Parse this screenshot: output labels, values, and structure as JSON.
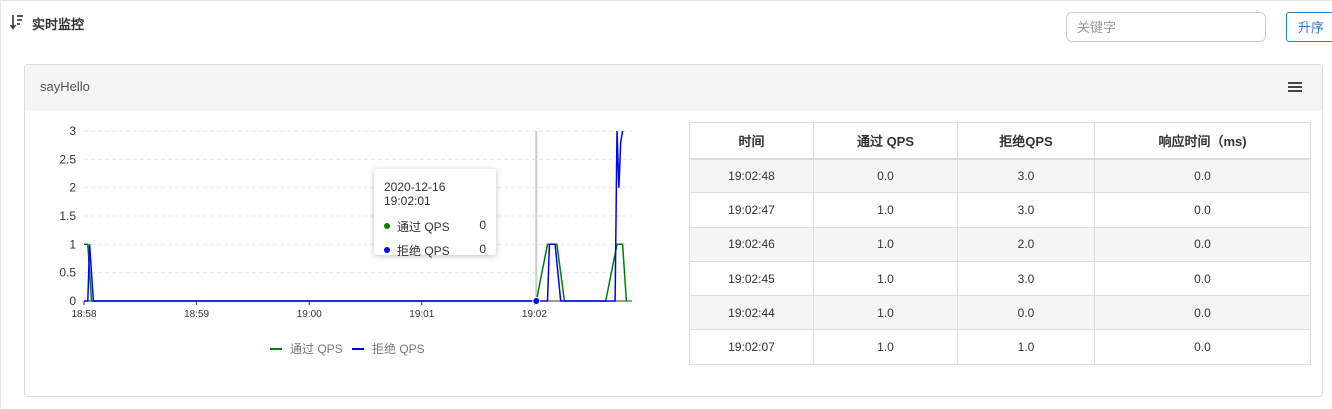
{
  "header": {
    "title": "实时监控",
    "search_placeholder": "关键字",
    "sort_button": "升序"
  },
  "panel": {
    "title": "sayHello"
  },
  "colors": {
    "pass": "#008000",
    "block": "#0000ff",
    "accent": "#2a7ec6"
  },
  "chart_data": {
    "type": "line",
    "y_ticks": [
      "0",
      "0.5",
      "1",
      "1.5",
      "2",
      "2.5",
      "3"
    ],
    "ylim": [
      0,
      3
    ],
    "x_ticks": [
      "18:58",
      "18:59",
      "19:00",
      "19:01",
      "19:02"
    ],
    "legend_position": "bottom",
    "series": [
      {
        "name": "通过 QPS",
        "color": "#008000",
        "points": [
          [
            "18:58:00",
            1
          ],
          [
            "18:58:02",
            1
          ],
          [
            "18:58:04",
            0
          ],
          [
            "18:58:05",
            0
          ],
          [
            "18:58:07",
            0
          ],
          [
            "19:02:01",
            0
          ],
          [
            "19:02:07",
            1
          ],
          [
            "19:02:12",
            1
          ],
          [
            "19:02:16",
            0
          ],
          [
            "19:02:20",
            0
          ],
          [
            "19:02:38",
            0
          ],
          [
            "19:02:44",
            1
          ],
          [
            "19:02:47",
            1
          ],
          [
            "19:02:49",
            0
          ]
        ]
      },
      {
        "name": "拒绝 QPS",
        "color": "#0000ff",
        "points": [
          [
            "18:58:00",
            0
          ],
          [
            "18:58:02",
            0
          ],
          [
            "18:58:03",
            1
          ],
          [
            "18:58:05",
            0
          ],
          [
            "19:02:01",
            0
          ],
          [
            "19:02:07",
            0
          ],
          [
            "19:02:08",
            1
          ],
          [
            "19:02:11",
            1
          ],
          [
            "19:02:14",
            0
          ],
          [
            "19:02:38",
            0
          ],
          [
            "19:02:43",
            0
          ],
          [
            "19:02:44",
            3
          ],
          [
            "19:02:45",
            2
          ],
          [
            "19:02:46",
            2.8
          ],
          [
            "19:02:47",
            3
          ]
        ]
      }
    ],
    "tooltip": {
      "title": "2020-12-16 19:02:01",
      "rows": [
        {
          "name": "通过 QPS",
          "value": "0",
          "color": "#008000"
        },
        {
          "name": "拒绝 QPS",
          "value": "0",
          "color": "#0000ff"
        }
      ]
    }
  },
  "table": {
    "headers": [
      "时间",
      "通过 QPS",
      "拒绝QPS",
      "响应时间（ms)"
    ],
    "rows": [
      [
        "19:02:48",
        "0.0",
        "3.0",
        "0.0"
      ],
      [
        "19:02:47",
        "1.0",
        "3.0",
        "0.0"
      ],
      [
        "19:02:46",
        "1.0",
        "2.0",
        "0.0"
      ],
      [
        "19:02:45",
        "1.0",
        "3.0",
        "0.0"
      ],
      [
        "19:02:44",
        "1.0",
        "0.0",
        "0.0"
      ],
      [
        "19:02:07",
        "1.0",
        "1.0",
        "0.0"
      ]
    ]
  }
}
